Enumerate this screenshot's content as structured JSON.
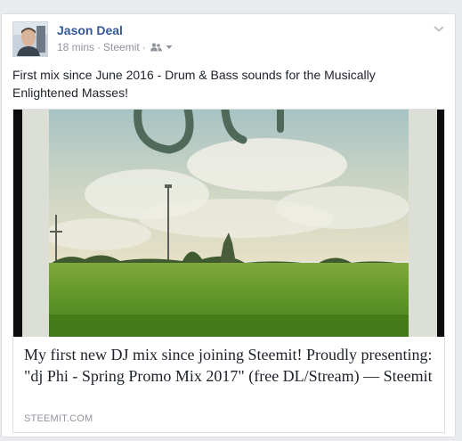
{
  "post": {
    "author": "Jason Deal",
    "time": "18 mins",
    "separator": "·",
    "app": "Steemit",
    "audience_icon": "friends-icon",
    "menu_icon": "chevron-down-icon",
    "message": "First mix since June 2016 - Drum & Bass sounds for the Musically Enlightened Masses!"
  },
  "share": {
    "title": "My first new DJ mix since joining Steemit! Proudly presenting: \"dj Phi - Spring Promo Mix 2017\" (free DL/Stream) — Steemit",
    "domain": "STEEMIT.COM"
  },
  "colors": {
    "name_link": "#365899",
    "meta_gray": "#90949c",
    "text": "#1d2129",
    "border": "#dddfe2"
  }
}
